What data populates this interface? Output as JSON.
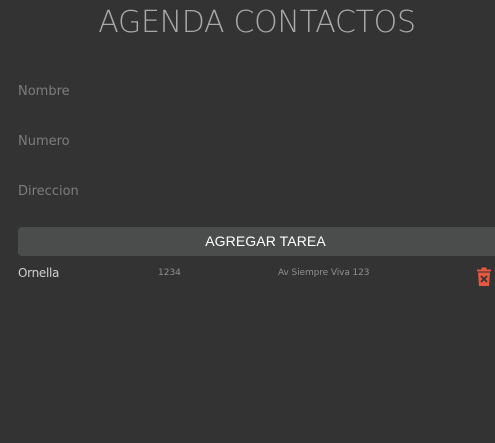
{
  "app": {
    "title": "AGENDA CONTACTOS"
  },
  "form": {
    "name_placeholder": "Nombre",
    "number_placeholder": "Numero",
    "address_placeholder": "Direccion",
    "name_value": "",
    "number_value": "",
    "address_value": "",
    "submit_label": "AGREGAR TAREA"
  },
  "contacts": [
    {
      "name": "Ornella",
      "number": "1234",
      "address": "Av Siempre Viva 123",
      "delete_icon": "trash-icon"
    }
  ],
  "colors": {
    "background": "#333333",
    "title": "#a9a9a9",
    "button": "#4b4c4c",
    "delete": "#e8573f"
  }
}
